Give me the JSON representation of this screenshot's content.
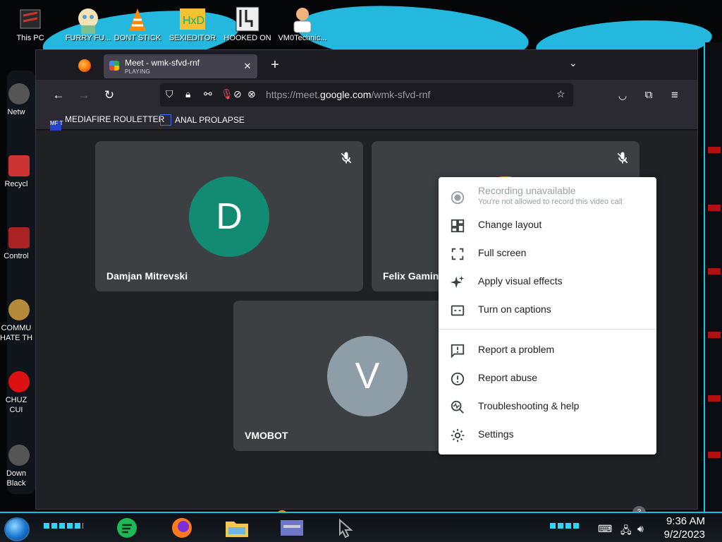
{
  "desktop": {
    "top_icons": [
      {
        "label": "This PC"
      },
      {
        "label": "FURRY FU..."
      },
      {
        "label": "DONT STICK"
      },
      {
        "label": "SEXIEDITOR"
      },
      {
        "label": "HOOKED ON"
      },
      {
        "label": "VM0Technic..."
      }
    ],
    "left_icons": [
      {
        "label": "Netw"
      },
      {
        "label": "Recycl"
      },
      {
        "label": "Control"
      },
      {
        "label": "COMMU"
      },
      {
        "label": "HATE TH"
      },
      {
        "label": "CHUZ"
      },
      {
        "label": "CUI"
      },
      {
        "label": "Down"
      },
      {
        "label": "Black"
      }
    ]
  },
  "browser": {
    "tab": {
      "title": "Meet - wmk-sfvd-rnf",
      "status": "PLAYING"
    },
    "url": {
      "prefix": "https://meet.",
      "domain": "google.com",
      "path": "/wmk-sfvd-rnf"
    },
    "bookmarks": [
      {
        "label": "MEDIAFIRE ROULETTER",
        "icon_text": "MF T"
      },
      {
        "label": "ANAL PROLAPSE"
      }
    ]
  },
  "meet": {
    "meeting_code": "wmk-sfvd-rnf",
    "participants": [
      {
        "name": "Damjan Mitrevski",
        "initial": "D",
        "color": "#138a72"
      },
      {
        "name": "Felix Gaming",
        "initial": "",
        "color": "#3c4043"
      },
      {
        "name": "VMOBOT",
        "initial": "V",
        "color": "#8d9ea7"
      }
    ],
    "people_count": "3",
    "camera_warning": "!",
    "menu": {
      "recording_title": "Recording unavailable",
      "recording_sub": "You're not allowed to record this video call",
      "items": [
        {
          "label": "Change layout"
        },
        {
          "label": "Full screen"
        },
        {
          "label": "Apply visual effects"
        },
        {
          "label": "Turn on captions"
        },
        {
          "label": "Report a problem"
        },
        {
          "label": "Report abuse"
        },
        {
          "label": "Troubleshooting & help"
        },
        {
          "label": "Settings"
        }
      ]
    },
    "colors": {
      "hangup": "#ea4335",
      "tile": "#3c4043",
      "background": "#202124"
    }
  },
  "taskbar": {
    "time": "9:36 AM",
    "date": "9/2/2023"
  }
}
